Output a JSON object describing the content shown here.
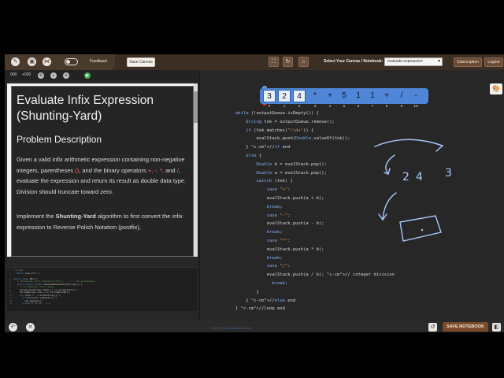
{
  "toolbar": {
    "feedback_label": "Feedback",
    "save_canvas_label": "Save Canvas",
    "canvas_label": "Select Your Canvas / Notebook:",
    "canvas_selected": "evaluate expression",
    "subscription_label": "Subscription",
    "logout_label": "Logout"
  },
  "strip": {
    "item1": "000",
    "item2": "+000"
  },
  "problem": {
    "title": "Evaluate Infix Expression (Shunting-Yard)",
    "section": "Problem Description",
    "p1_a": "Given a valid infix arithmetic expression containing non-negative integers, parentheses ",
    "p1_paren": "()",
    "p1_b": ", and the binary operators ",
    "p1_ops": "+, -, *,",
    "p1_c": " and ",
    "p1_div": "/",
    "p1_d": ", evaluate the expression and return its result as double data type. Division should truncate toward zero.",
    "p2_a": "Implement the ",
    "p2_bold": "Shunting-Yard",
    "p2_b": " algorithm to first convert the infix expression to Reverse Polish Notation (postfix),"
  },
  "array": {
    "values": [
      "3",
      "2",
      "4",
      "*",
      "+",
      "5",
      "1",
      "1",
      "+",
      "/",
      "-"
    ],
    "indices": [
      "0",
      "1",
      "2",
      "3",
      "4",
      "5",
      "6",
      "7",
      "8",
      "9",
      "10"
    ]
  },
  "code_lines": [
    "while (!outputQueue.isEmpty()) {",
    "    String tok = outputQueue.remove();",
    "    if (tok.matches(\"\\\\d+\")) {",
    "        evalStack.push(Double.valueOf(tok));",
    "    } //if end",
    "    else {",
    "        Double b = evalStack.pop();",
    "        Double a = evalStack.pop();",
    "        switch (tok) {",
    "            case \"+\":",
    "            evalStack.push(a + b);",
    "            break;",
    "            case \"-\":",
    "            evalStack.push(a - b);",
    "            break;",
    "            case \"*\":",
    "            evalStack.push(a * b);",
    "            break;",
    "            case \"/\":",
    "            evalStack.push(a / b); // integer division",
    "              break;",
    "        }",
    "    } //else end",
    "} //loop end"
  ],
  "footer": {
    "copyright": "© 2025 Priority Notes Limited",
    "save_notebook_label": "SAVE NOTEBOOK"
  },
  "sketch": {
    "text_2": "2",
    "text_4": "4",
    "text_3": "3",
    "color": "#a9c8ff"
  }
}
